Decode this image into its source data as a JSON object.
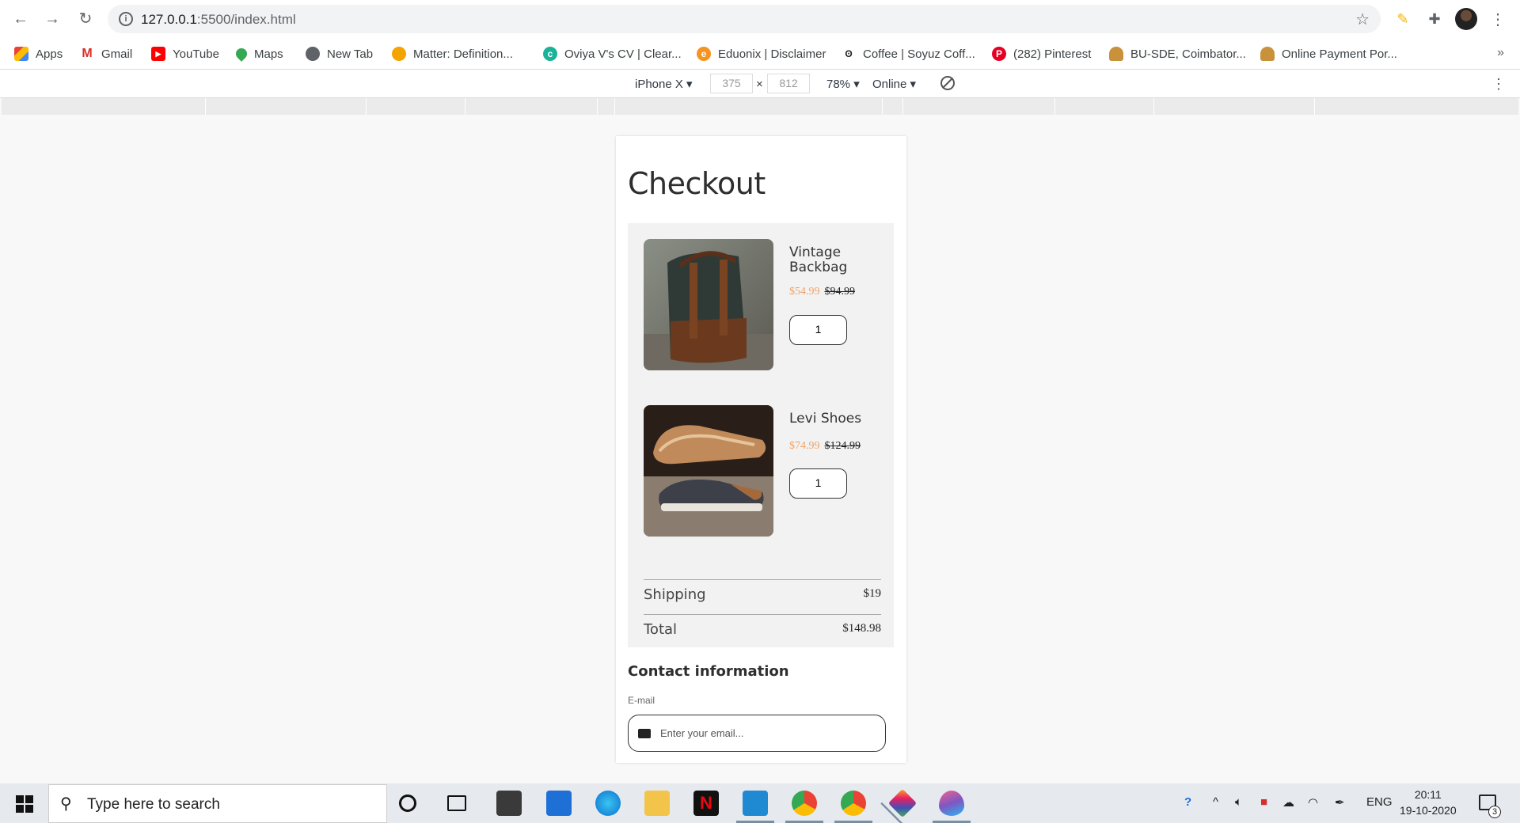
{
  "browser": {
    "url_host": "127.0.0.1",
    "url_path": ":5500/index.html",
    "bookmarks": [
      {
        "label": "Apps",
        "icon": "apps-grid-icon"
      },
      {
        "label": "Gmail",
        "icon": "gmail-icon"
      },
      {
        "label": "YouTube",
        "icon": "youtube-icon"
      },
      {
        "label": "Maps",
        "icon": "maps-icon"
      },
      {
        "label": "New Tab",
        "icon": "globe-icon"
      },
      {
        "label": "Matter: Definition...",
        "icon": "matter-icon"
      },
      {
        "label": "Oviya V's CV | Clear...",
        "icon": "cv-icon"
      },
      {
        "label": "Eduonix | Disclaimer",
        "icon": "eduonix-icon"
      },
      {
        "label": "Coffee | Soyuz Coff...",
        "icon": "coffee-icon"
      },
      {
        "label": "(282) Pinterest",
        "icon": "pinterest-icon"
      },
      {
        "label": "BU-SDE, Coimbator...",
        "icon": "user-icon"
      },
      {
        "label": "Online Payment Por...",
        "icon": "user-icon"
      }
    ],
    "more_bookmarks": "»"
  },
  "devtools": {
    "device": "iPhone X",
    "width": "375",
    "times": "×",
    "height": "812",
    "zoom": "78%",
    "network": "Online"
  },
  "page": {
    "title": "Checkout",
    "products": [
      {
        "name": "Vintage Backbag",
        "price": "$54.99",
        "old_price": "$94.99",
        "qty": "1"
      },
      {
        "name": "Levi Shoes",
        "price": "$74.99",
        "old_price": "$124.99",
        "qty": "1"
      }
    ],
    "shipping_label": "Shipping",
    "shipping_value": "$19",
    "total_label": "Total",
    "total_value": "$148.98",
    "contact_heading": "Contact information",
    "email_label": "E-mail",
    "email_placeholder": "Enter your email..."
  },
  "taskbar": {
    "search_text": "Type here to search",
    "language": "ENG",
    "time": "20:11",
    "date": "19-10-2020",
    "notification_count": "3"
  }
}
